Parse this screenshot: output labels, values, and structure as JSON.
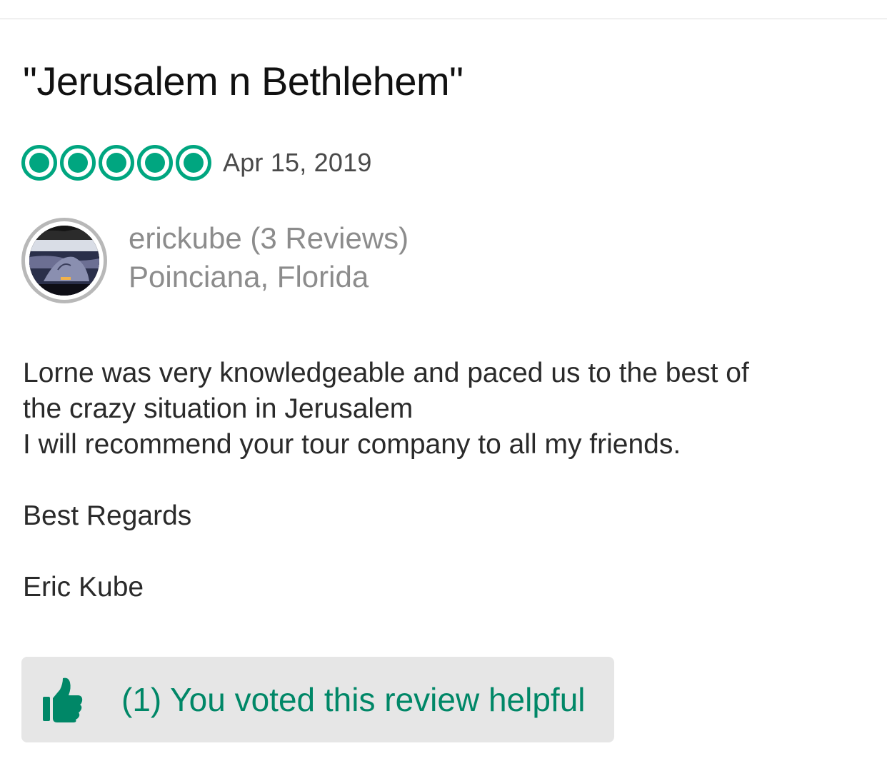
{
  "review": {
    "title": "\"Jerusalem n Bethlehem\"",
    "rating": 5,
    "rating_max": 5,
    "date": "Apr 15, 2019",
    "body_lines": [
      "Lorne was very knowledgeable and paced us to the best of",
      "the crazy situation in Jerusalem",
      "I will recommend your tour company to all my friends.",
      "",
      "Best Regards",
      "",
      "Eric Kube"
    ]
  },
  "reviewer": {
    "name_line": "erickube (3 Reviews)",
    "location": "Poinciana, Florida"
  },
  "helpful": {
    "label": "(1) You voted this review helpful"
  },
  "colors": {
    "accent_green": "#00a680",
    "helpful_text": "#008767",
    "button_bg": "#e6e6e6",
    "muted_text": "#8c8c8c"
  },
  "icons": {
    "rating": "bubble-rating-icon",
    "helpful": "thumbs-up-icon"
  }
}
